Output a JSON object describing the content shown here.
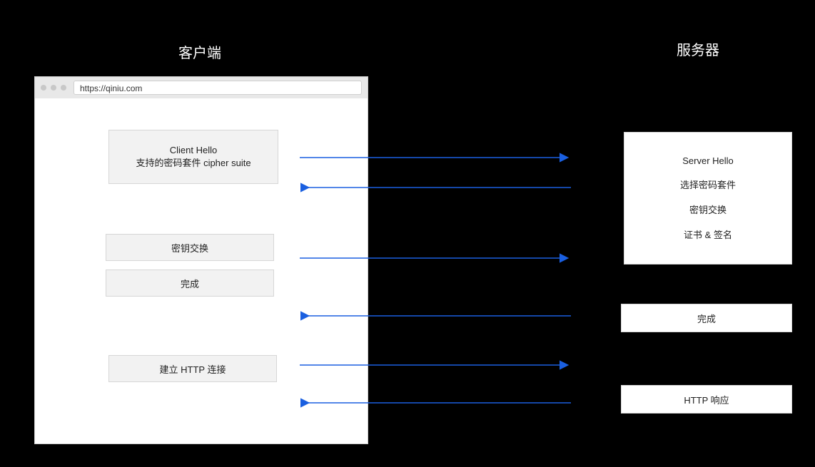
{
  "headers": {
    "client": "客户端",
    "server": "服务器"
  },
  "browser": {
    "url": "https://qiniu.com"
  },
  "client_boxes": {
    "hello_line1": "Client Hello",
    "hello_line2": "支持的密码套件 cipher suite",
    "key_exchange": "密钥交换",
    "done": "完成",
    "http_conn": "建立 HTTP 连接"
  },
  "server_boxes": {
    "hello_line1": "Server Hello",
    "hello_line2": "选择密码套件",
    "hello_line3": "密钥交换",
    "hello_line4": "证书 & 签名",
    "done": "完成",
    "http_resp": "HTTP 响应"
  },
  "arrows": {
    "color": "#1a5fe0"
  }
}
